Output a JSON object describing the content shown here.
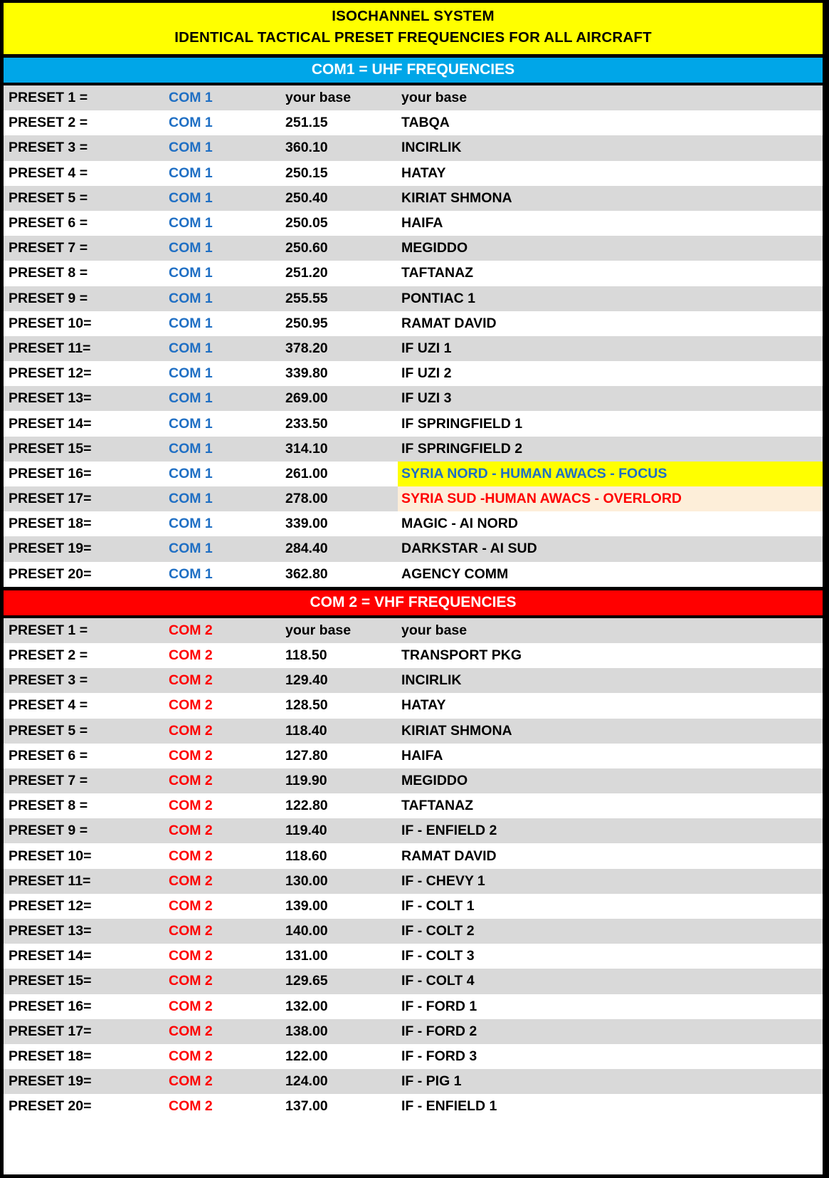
{
  "title": {
    "line1": "ISOCHANNEL SYSTEM",
    "line2": "IDENTICAL TACTICAL PRESET FREQUENCIES FOR ALL AIRCRAFT",
    "background": "#ffff00",
    "text_color": "#000000"
  },
  "sections": [
    {
      "header": "COM1 =  UHF FREQUENCIES",
      "header_background": "#00a6e8",
      "header_text_color": "#ffffff",
      "com_label_color": "#1f6fc4",
      "rows": [
        {
          "preset": "PRESET 1 =",
          "com": "COM 1",
          "freq": "your base",
          "location": "your base"
        },
        {
          "preset": "PRESET 2 =",
          "com": "COM 1",
          "freq": "251.15",
          "location": "TABQA"
        },
        {
          "preset": "PRESET 3 =",
          "com": "COM 1",
          "freq": "360.10",
          "location": "INCIRLIK"
        },
        {
          "preset": "PRESET 4 =",
          "com": "COM 1",
          "freq": "250.15",
          "location": "HATAY"
        },
        {
          "preset": "PRESET 5 =",
          "com": "COM 1",
          "freq": "250.40",
          "location": "KIRIAT SHMONA"
        },
        {
          "preset": "PRESET 6 =",
          "com": "COM 1",
          "freq": "250.05",
          "location": "HAIFA"
        },
        {
          "preset": "PRESET 7 =",
          "com": "COM 1",
          "freq": "250.60",
          "location": "MEGIDDO"
        },
        {
          "preset": "PRESET 8 =",
          "com": "COM 1",
          "freq": "251.20",
          "location": "TAFTANAZ"
        },
        {
          "preset": "PRESET 9 =",
          "com": "COM 1",
          "freq": "255.55",
          "location": "PONTIAC 1"
        },
        {
          "preset": "PRESET 10=",
          "com": "COM 1",
          "freq": "250.95",
          "location": "RAMAT DAVID"
        },
        {
          "preset": "PRESET 11=",
          "com": "COM 1",
          "freq": "378.20",
          "location": "IF UZI 1"
        },
        {
          "preset": "PRESET 12=",
          "com": "COM 1",
          "freq": "339.80",
          "location": "IF UZI 2"
        },
        {
          "preset": "PRESET 13=",
          "com": "COM 1",
          "freq": "269.00",
          "location": "IF UZI 3"
        },
        {
          "preset": "PRESET 14=",
          "com": "COM 1",
          "freq": "233.50",
          "location": "IF SPRINGFIELD 1"
        },
        {
          "preset": "PRESET 15=",
          "com": "COM 1",
          "freq": "314.10",
          "location": "IF SPRINGFIELD 2"
        },
        {
          "preset": "PRESET 16=",
          "com": "COM 1",
          "freq": "261.00",
          "location": "SYRIA NORD - HUMAN AWACS - FOCUS",
          "highlight": "yellow",
          "highlight_background": "#ffff00",
          "highlight_text_color": "#1f6fc4"
        },
        {
          "preset": "PRESET 17=",
          "com": "COM 1",
          "freq": "278.00",
          "location": "SYRIA SUD -HUMAN AWACS - OVERLORD",
          "highlight": "cream",
          "highlight_background": "#fdeed9",
          "highlight_text_color": "#ff0000"
        },
        {
          "preset": "PRESET 18=",
          "com": "COM 1",
          "freq": "339.00",
          "location": "MAGIC - AI NORD"
        },
        {
          "preset": "PRESET 19=",
          "com": "COM 1",
          "freq": "284.40",
          "location": "DARKSTAR - AI SUD"
        },
        {
          "preset": "PRESET 20=",
          "com": "COM 1",
          "freq": "362.80",
          "location": "AGENCY COMM"
        }
      ]
    },
    {
      "header": "COM 2 = VHF FREQUENCIES",
      "header_background": "#ff0000",
      "header_text_color": "#ffffff",
      "com_label_color": "#ff0000",
      "rows": [
        {
          "preset": "PRESET 1 =",
          "com": "COM 2",
          "freq": "your base",
          "location": "your base"
        },
        {
          "preset": "PRESET 2 =",
          "com": "COM 2",
          "freq": "118.50",
          "location": "TRANSPORT PKG"
        },
        {
          "preset": "PRESET 3 =",
          "com": "COM 2",
          "freq": "129.40",
          "location": "INCIRLIK"
        },
        {
          "preset": "PRESET 4 =",
          "com": "COM 2",
          "freq": "128.50",
          "location": "HATAY"
        },
        {
          "preset": "PRESET 5 =",
          "com": "COM 2",
          "freq": "118.40",
          "location": "KIRIAT SHMONA"
        },
        {
          "preset": "PRESET 6 =",
          "com": "COM 2",
          "freq": "127.80",
          "location": "HAIFA"
        },
        {
          "preset": "PRESET 7 =",
          "com": "COM 2",
          "freq": "119.90",
          "location": "MEGIDDO"
        },
        {
          "preset": "PRESET 8 =",
          "com": "COM 2",
          "freq": "122.80",
          "location": "TAFTANAZ"
        },
        {
          "preset": "PRESET 9 =",
          "com": "COM 2",
          "freq": "119.40",
          "location": "IF - ENFIELD 2"
        },
        {
          "preset": "PRESET 10=",
          "com": "COM 2",
          "freq": "118.60",
          "location": "RAMAT DAVID"
        },
        {
          "preset": "PRESET 11=",
          "com": "COM 2",
          "freq": "130.00",
          "location": "IF - CHEVY 1"
        },
        {
          "preset": "PRESET 12=",
          "com": "COM 2",
          "freq": "139.00",
          "location": "IF - COLT 1"
        },
        {
          "preset": "PRESET 13=",
          "com": "COM 2",
          "freq": "140.00",
          "location": "IF - COLT 2"
        },
        {
          "preset": "PRESET 14=",
          "com": "COM 2",
          "freq": "131.00",
          "location": "IF - COLT 3"
        },
        {
          "preset": "PRESET 15=",
          "com": "COM 2",
          "freq": "129.65",
          "location": "IF - COLT 4"
        },
        {
          "preset": "PRESET 16=",
          "com": "COM 2",
          "freq": "132.00",
          "location": "IF - FORD 1"
        },
        {
          "preset": "PRESET 17=",
          "com": "COM 2",
          "freq": "138.00",
          "location": "IF - FORD 2"
        },
        {
          "preset": "PRESET 18=",
          "com": "COM 2",
          "freq": "122.00",
          "location": "IF - FORD 3"
        },
        {
          "preset": "PRESET 19=",
          "com": "COM 2",
          "freq": "124.00",
          "location": "IF - PIG 1"
        },
        {
          "preset": "PRESET 20=",
          "com": "COM 2",
          "freq": "137.00",
          "location": "IF - ENFIELD 1"
        }
      ]
    }
  ]
}
